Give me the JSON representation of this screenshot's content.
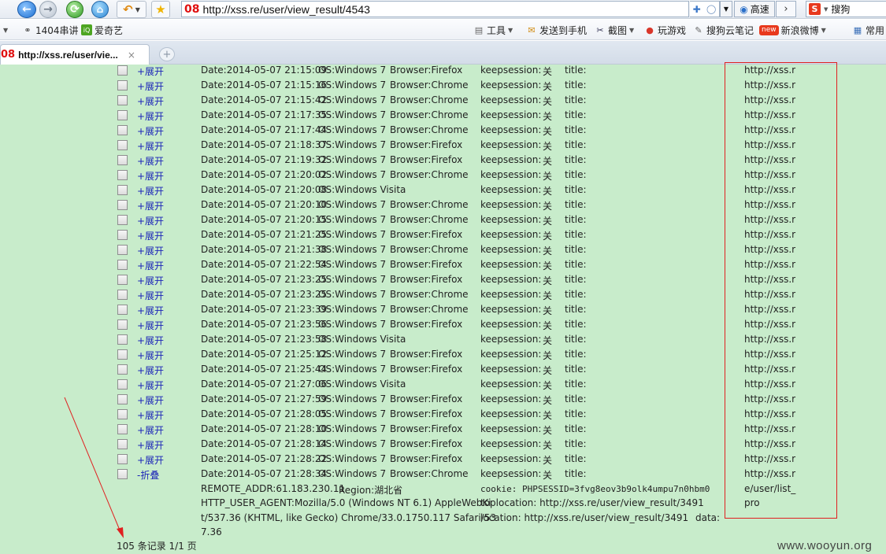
{
  "browser": {
    "url": "http://xss.re/user/view_result/4543",
    "site_badge": "08",
    "speed_label": "高速",
    "search_label": "搜狗",
    "go_glyph": "›"
  },
  "bookmarks": [
    {
      "label": "1404串讲",
      "icon": "link-icon"
    },
    {
      "label": "爱奇艺",
      "icon": "iqiyi-icon"
    }
  ],
  "toolbar": {
    "tools": "工具",
    "send_phone": "发送到手机",
    "screenshot": "截图",
    "games": "玩游戏",
    "notes": "搜狗云笔记",
    "weibo_badge": "new",
    "weibo": "新浪微博",
    "common": "常用"
  },
  "tab": {
    "title": "http://xss.re/user/vie...",
    "badge": "08",
    "close_glyph": "×",
    "new_tab_glyph": "+"
  },
  "records": [
    {
      "toggle": "+展开",
      "date": "Date:2014-05-07 21:15:09",
      "os": "OS:Windows 7",
      "browser": "Browser:Firefox",
      "keep_label": "keepsession:",
      "keep_value": "关",
      "title": "title:",
      "url": "http://xss.r"
    },
    {
      "toggle": "+展开",
      "date": "Date:2014-05-07 21:15:16",
      "os": "OS:Windows 7",
      "browser": "Browser:Chrome",
      "keep_label": "keepsession:",
      "keep_value": "关",
      "title": "title:",
      "url": "http://xss.r"
    },
    {
      "toggle": "+展开",
      "date": "Date:2014-05-07 21:15:42",
      "os": "OS:Windows 7",
      "browser": "Browser:Chrome",
      "keep_label": "keepsession:",
      "keep_value": "关",
      "title": "title:",
      "url": "http://xss.r"
    },
    {
      "toggle": "+展开",
      "date": "Date:2014-05-07 21:17:35",
      "os": "OS:Windows 7",
      "browser": "Browser:Chrome",
      "keep_label": "keepsession:",
      "keep_value": "关",
      "title": "title:",
      "url": "http://xss.r"
    },
    {
      "toggle": "+展开",
      "date": "Date:2014-05-07 21:17:44",
      "os": "OS:Windows 7",
      "browser": "Browser:Chrome",
      "keep_label": "keepsession:",
      "keep_value": "关",
      "title": "title:",
      "url": "http://xss.r"
    },
    {
      "toggle": "+展开",
      "date": "Date:2014-05-07 21:18:37",
      "os": "OS:Windows 7",
      "browser": "Browser:Firefox",
      "keep_label": "keepsession:",
      "keep_value": "关",
      "title": "title:",
      "url": "http://xss.r"
    },
    {
      "toggle": "+展开",
      "date": "Date:2014-05-07 21:19:32",
      "os": "OS:Windows 7",
      "browser": "Browser:Firefox",
      "keep_label": "keepsession:",
      "keep_value": "关",
      "title": "title:",
      "url": "http://xss.r"
    },
    {
      "toggle": "+展开",
      "date": "Date:2014-05-07 21:20:02",
      "os": "OS:Windows 7",
      "browser": "Browser:Chrome",
      "keep_label": "keepsession:",
      "keep_value": "关",
      "title": "title:",
      "url": "http://xss.r"
    },
    {
      "toggle": "+展开",
      "date": "Date:2014-05-07 21:20:08",
      "os": "OS:Windows Visita",
      "browser": "",
      "keep_label": "keepsession:",
      "keep_value": "关",
      "title": "title:",
      "url": "http://xss.r"
    },
    {
      "toggle": "+展开",
      "date": "Date:2014-05-07 21:20:10",
      "os": "OS:Windows 7",
      "browser": "Browser:Chrome",
      "keep_label": "keepsession:",
      "keep_value": "关",
      "title": "title:",
      "url": "http://xss.r"
    },
    {
      "toggle": "+展开",
      "date": "Date:2014-05-07 21:20:15",
      "os": "OS:Windows 7",
      "browser": "Browser:Chrome",
      "keep_label": "keepsession:",
      "keep_value": "关",
      "title": "title:",
      "url": "http://xss.r"
    },
    {
      "toggle": "+展开",
      "date": "Date:2014-05-07 21:21:25",
      "os": "OS:Windows 7",
      "browser": "Browser:Firefox",
      "keep_label": "keepsession:",
      "keep_value": "关",
      "title": "title:",
      "url": "http://xss.r"
    },
    {
      "toggle": "+展开",
      "date": "Date:2014-05-07 21:21:38",
      "os": "OS:Windows 7",
      "browser": "Browser:Chrome",
      "keep_label": "keepsession:",
      "keep_value": "关",
      "title": "title:",
      "url": "http://xss.r"
    },
    {
      "toggle": "+展开",
      "date": "Date:2014-05-07 21:22:54",
      "os": "OS:Windows 7",
      "browser": "Browser:Firefox",
      "keep_label": "keepsession:",
      "keep_value": "关",
      "title": "title:",
      "url": "http://xss.r"
    },
    {
      "toggle": "+展开",
      "date": "Date:2014-05-07 21:23:25",
      "os": "OS:Windows 7",
      "browser": "Browser:Firefox",
      "keep_label": "keepsession:",
      "keep_value": "关",
      "title": "title:",
      "url": "http://xss.r"
    },
    {
      "toggle": "+展开",
      "date": "Date:2014-05-07 21:23:25",
      "os": "OS:Windows 7",
      "browser": "Browser:Chrome",
      "keep_label": "keepsession:",
      "keep_value": "关",
      "title": "title:",
      "url": "http://xss.r"
    },
    {
      "toggle": "+展开",
      "date": "Date:2014-05-07 21:23:39",
      "os": "OS:Windows 7",
      "browser": "Browser:Chrome",
      "keep_label": "keepsession:",
      "keep_value": "关",
      "title": "title:",
      "url": "http://xss.r"
    },
    {
      "toggle": "+展开",
      "date": "Date:2014-05-07 21:23:56",
      "os": "OS:Windows 7",
      "browser": "Browser:Firefox",
      "keep_label": "keepsession:",
      "keep_value": "关",
      "title": "title:",
      "url": "http://xss.r"
    },
    {
      "toggle": "+展开",
      "date": "Date:2014-05-07 21:23:58",
      "os": "OS:Windows Visita",
      "browser": "",
      "keep_label": "keepsession:",
      "keep_value": "关",
      "title": "title:",
      "url": "http://xss.r"
    },
    {
      "toggle": "+展开",
      "date": "Date:2014-05-07 21:25:12",
      "os": "OS:Windows 7",
      "browser": "Browser:Firefox",
      "keep_label": "keepsession:",
      "keep_value": "关",
      "title": "title:",
      "url": "http://xss.r"
    },
    {
      "toggle": "+展开",
      "date": "Date:2014-05-07 21:25:44",
      "os": "OS:Windows 7",
      "browser": "Browser:Firefox",
      "keep_label": "keepsession:",
      "keep_value": "关",
      "title": "title:",
      "url": "http://xss.r"
    },
    {
      "toggle": "+展开",
      "date": "Date:2014-05-07 21:27:06",
      "os": "OS:Windows Visita",
      "browser": "",
      "keep_label": "keepsession:",
      "keep_value": "关",
      "title": "title:",
      "url": "http://xss.r"
    },
    {
      "toggle": "+展开",
      "date": "Date:2014-05-07 21:27:59",
      "os": "OS:Windows 7",
      "browser": "Browser:Firefox",
      "keep_label": "keepsession:",
      "keep_value": "关",
      "title": "title:",
      "url": "http://xss.r"
    },
    {
      "toggle": "+展开",
      "date": "Date:2014-05-07 21:28:05",
      "os": "OS:Windows 7",
      "browser": "Browser:Firefox",
      "keep_label": "keepsession:",
      "keep_value": "关",
      "title": "title:",
      "url": "http://xss.r"
    },
    {
      "toggle": "+展开",
      "date": "Date:2014-05-07 21:28:10",
      "os": "OS:Windows 7",
      "browser": "Browser:Firefox",
      "keep_label": "keepsession:",
      "keep_value": "关",
      "title": "title:",
      "url": "http://xss.r"
    },
    {
      "toggle": "+展开",
      "date": "Date:2014-05-07 21:28:14",
      "os": "OS:Windows 7",
      "browser": "Browser:Firefox",
      "keep_label": "keepsession:",
      "keep_value": "关",
      "title": "title:",
      "url": "http://xss.r"
    },
    {
      "toggle": "+展开",
      "date": "Date:2014-05-07 21:28:22",
      "os": "OS:Windows 7",
      "browser": "Browser:Firefox",
      "keep_label": "keepsession:",
      "keep_value": "关",
      "title": "title:",
      "url": "http://xss.r"
    },
    {
      "toggle": "-折叠",
      "date": "Date:2014-05-07 21:28:34",
      "os": "OS:Windows 7",
      "browser": "Browser:Chrome",
      "keep_label": "keepsession:",
      "keep_value": "关",
      "title": "title:",
      "url": "http://xss.r"
    }
  ],
  "expanded": {
    "remote_addr": "REMOTE_ADDR:61.183.230.11",
    "region": "Region:湖北省",
    "cookie": "cookie: PHPSESSID=3fvg8eov3b9olk4umpu7n0hbm0",
    "url_cont_1": "e/user/list_",
    "url_cont_2": "pro",
    "ua_1": "HTTP_USER_AGENT:Mozilla/5.0 (Windows NT 6.1) AppleWebKi",
    "ua_2": "t/537.36 (KHTML, like Gecko) Chrome/33.0.1750.117 Safari/53",
    "ua_3": "7.36",
    "toplocation": "toplocation:  http://xss.re/user/view_result/3491",
    "location": "location:  http://xss.re/user/view_result/3491",
    "data": "data:"
  },
  "footer": {
    "records_text": "105 条记录 1/1 页",
    "watermark": "www.wooyun.org"
  },
  "colors": {
    "content_bg": "#c8eccb",
    "toggle_link": "#1a23b8",
    "annotation": "#e02020"
  }
}
